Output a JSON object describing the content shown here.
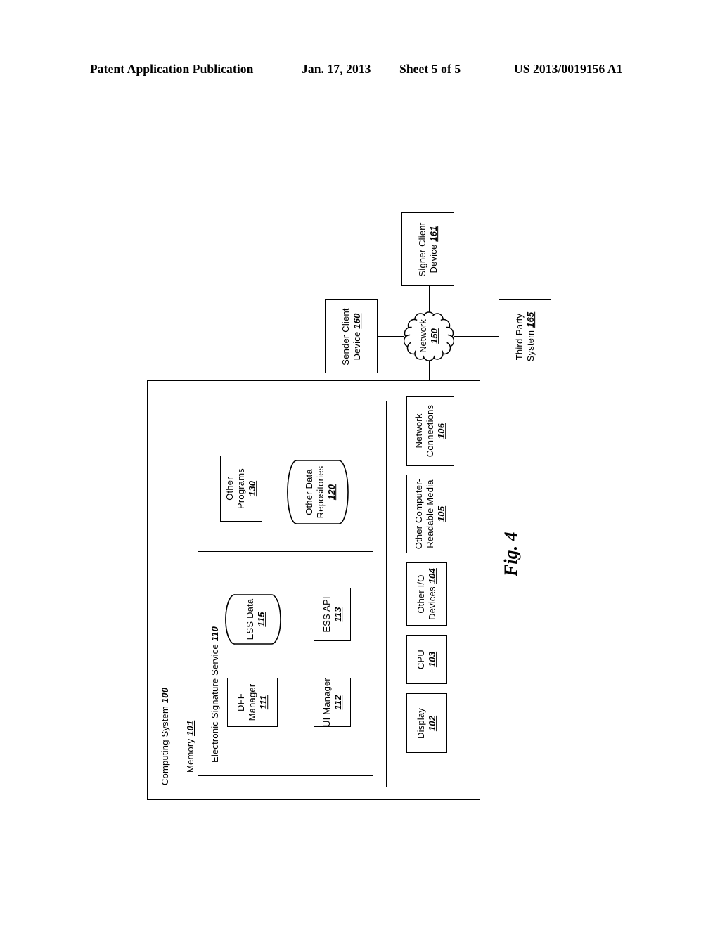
{
  "header": {
    "publication": "Patent Application Publication",
    "date": "Jan. 17, 2013",
    "sheet": "Sheet 5 of 5",
    "number": "US 2013/0019156 A1"
  },
  "figure": {
    "caption": "Fig. 4"
  },
  "diagram": {
    "computing_system": {
      "label": "Computing System",
      "num": "100"
    },
    "memory": {
      "label": "Memory",
      "num": "101"
    },
    "ess": {
      "label": "Electronic Signature Service",
      "num": "110"
    },
    "dff_manager": {
      "line1": "DFF",
      "line2": "Manager",
      "num": "111"
    },
    "ui_manager": {
      "line1": "UI Manager",
      "num": "112"
    },
    "ess_data": {
      "line1": "ESS Data",
      "num": "115"
    },
    "ess_api": {
      "line1": "ESS API",
      "num": "113"
    },
    "other_programs": {
      "line1": "Other",
      "line2": "Programs",
      "num": "130"
    },
    "other_data_repositories": {
      "line1": "Other Data",
      "line2": "Repositories",
      "num": "120"
    },
    "display": {
      "line1": "Display",
      "num": "102"
    },
    "cpu": {
      "line1": "CPU",
      "num": "103"
    },
    "other_io": {
      "line1": "Other I/O",
      "line2": "Devices",
      "num": "104"
    },
    "other_media": {
      "line1": "Other Computer-",
      "line2": "Readable Media",
      "num": "105"
    },
    "network_connections": {
      "line1": "Network",
      "line2": "Connections",
      "num": "106"
    },
    "network": {
      "label": "Network",
      "num": "150"
    },
    "sender_client": {
      "line1": "Sender Client",
      "line2": "Device",
      "num": "160"
    },
    "signer_client": {
      "line1": "Signer Client",
      "line2": "Device",
      "num": "161"
    },
    "third_party": {
      "line1": "Third-Party",
      "line2": "System",
      "num": "165"
    }
  }
}
